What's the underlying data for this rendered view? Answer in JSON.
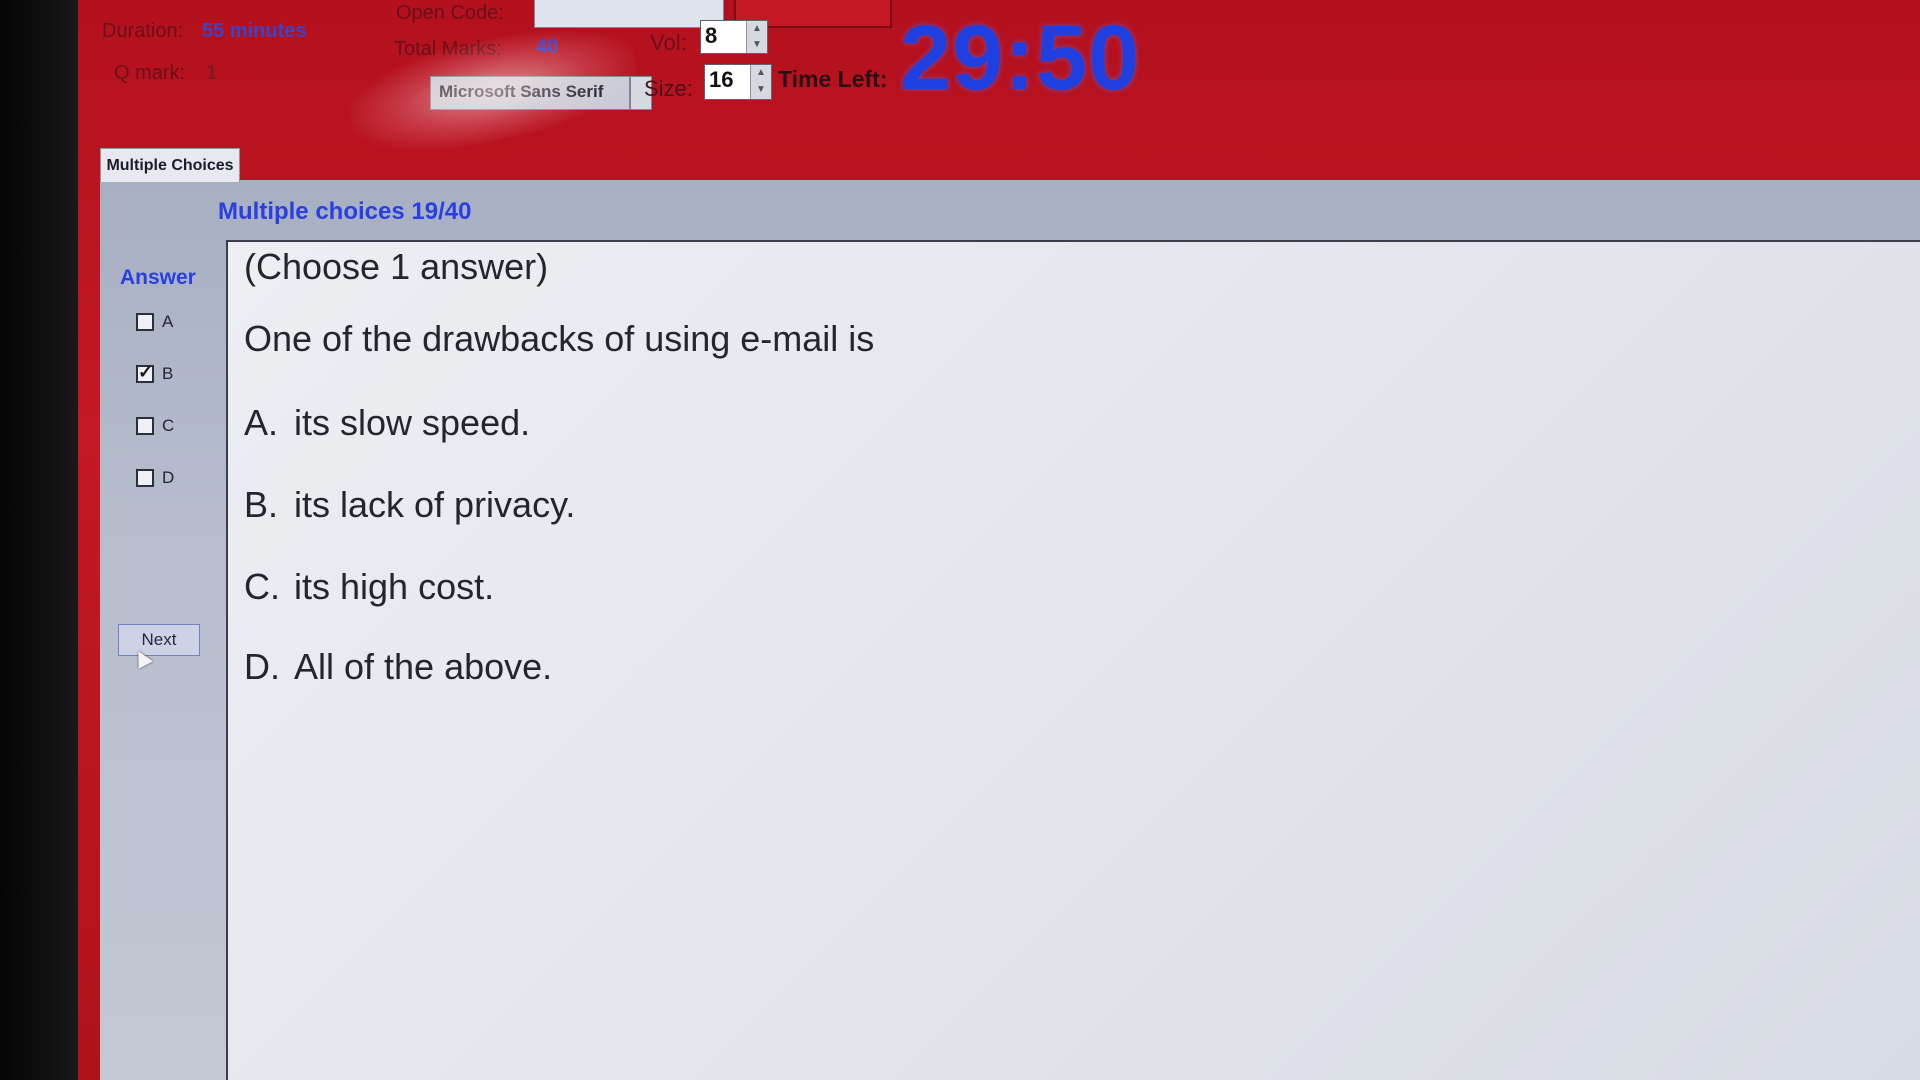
{
  "header": {
    "duration_label": "Duration:",
    "duration_value": "55 minutes",
    "qmark_label": "Q mark:",
    "qmark_value": "1",
    "open_code_label": "Open Code:",
    "total_marks_label": "Total Marks:",
    "total_marks_value": "40",
    "vol_label": "Vol:",
    "vol_value": "8",
    "font_value": "Microsoft Sans Serif",
    "size_label": "Size:",
    "size_value": "16",
    "time_left_label": "Time Left:",
    "time_left_value": "29:50"
  },
  "tab": {
    "label": "Multiple Choices"
  },
  "section": {
    "title": "Multiple choices 19/40"
  },
  "answers": {
    "label": "Answer",
    "options": [
      {
        "letter": "A",
        "checked": false
      },
      {
        "letter": "B",
        "checked": true
      },
      {
        "letter": "C",
        "checked": false
      },
      {
        "letter": "D",
        "checked": false
      }
    ],
    "next_label": "Next"
  },
  "question": {
    "instruction": "(Choose 1 answer)",
    "stem": "One of the drawbacks of using e-mail is",
    "choices": [
      {
        "letter": "A.",
        "text": "its slow speed."
      },
      {
        "letter": "B.",
        "text": "its lack of privacy."
      },
      {
        "letter": "C.",
        "text": "its high cost."
      },
      {
        "letter": "D.",
        "text": "All of the above."
      }
    ]
  },
  "colors": {
    "header_bg": "#c41825",
    "timer": "#1f3fe0",
    "accent_blue": "#2a3fe0"
  }
}
